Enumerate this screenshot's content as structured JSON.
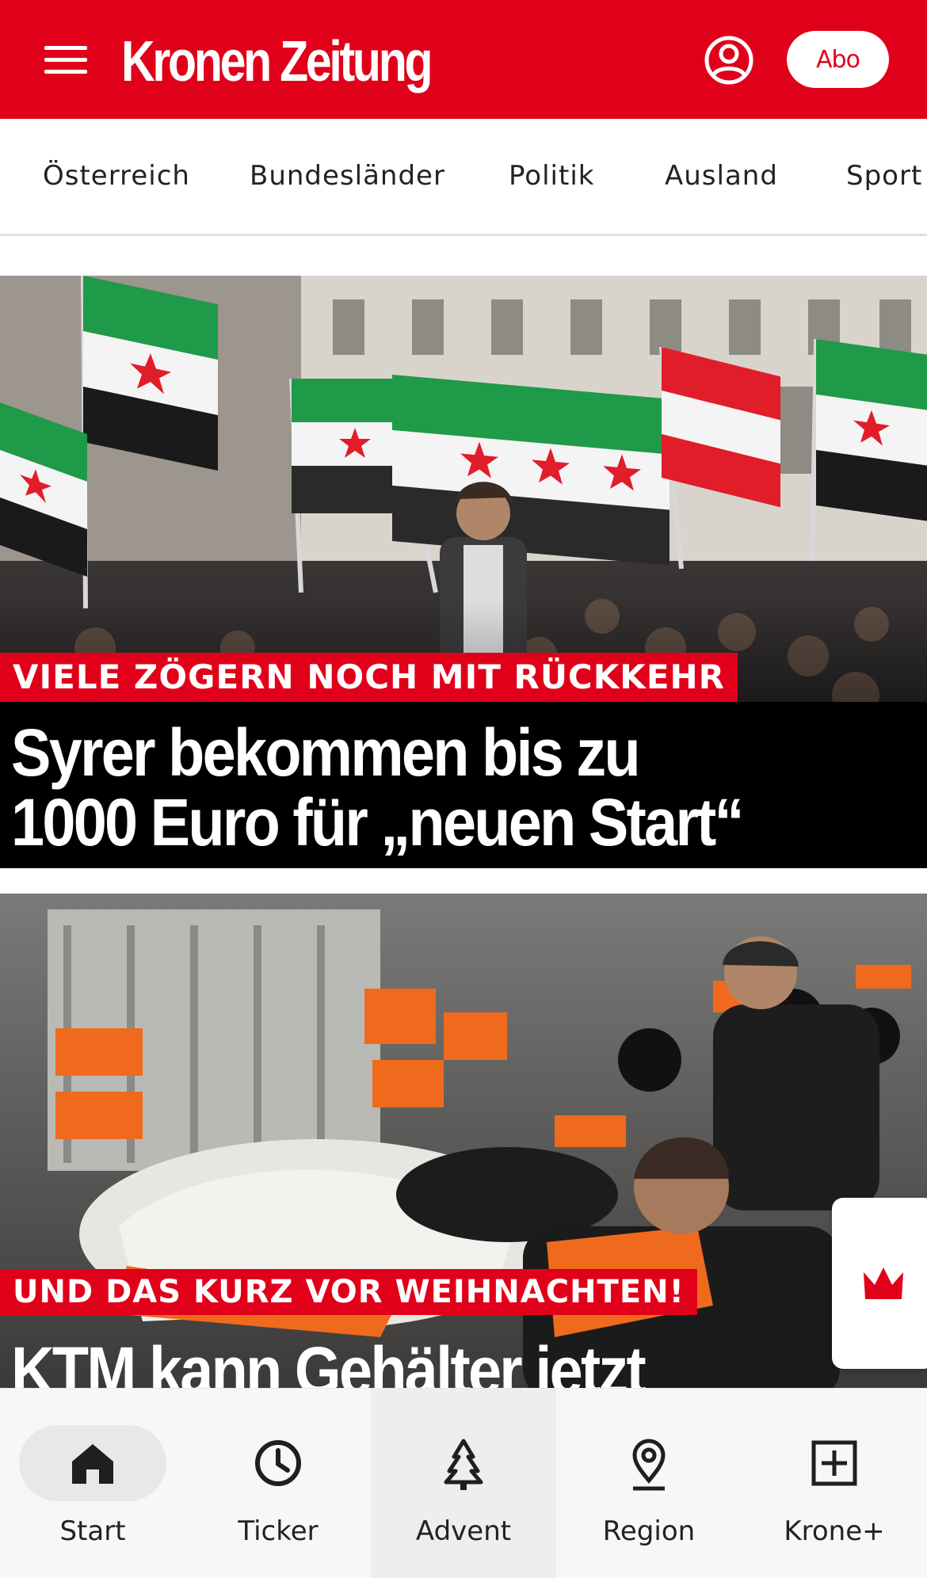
{
  "header": {
    "logo_text": "Kronen Zeitung",
    "subscribe_label": "Abo",
    "brand_color": "#e1001a",
    "menu_icon": "hamburger-menu-icon",
    "account_icon": "user-account-icon"
  },
  "nav": {
    "items": [
      {
        "label": "Österreich"
      },
      {
        "label": "Bundesländer"
      },
      {
        "label": "Politik"
      },
      {
        "label": "Ausland"
      },
      {
        "label": "Sport"
      }
    ]
  },
  "articles": [
    {
      "kicker": "VIELE ZÖGERN NOCH MIT RÜCKKEHR",
      "headline_line1": "Syrer bekommen bis zu",
      "headline_line2": "1000 Euro für „neuen Start“",
      "image_alt": "Crowd waving Syrian opposition flags and an Austrian flag"
    },
    {
      "kicker": "UND DAS KURZ VOR WEIHNACHTEN!",
      "headline_line1": "KTM kann Gehälter jetzt",
      "image_alt": "Workers assembling orange motorcycles in a factory"
    }
  ],
  "floating_button": {
    "icon": "krone-crown-icon"
  },
  "bottom_nav": {
    "items": [
      {
        "label": "Start",
        "icon": "home-icon",
        "active": true
      },
      {
        "label": "Ticker",
        "icon": "clock-icon"
      },
      {
        "label": "Advent",
        "icon": "tree-icon"
      },
      {
        "label": "Region",
        "icon": "location-pin-icon"
      },
      {
        "label": "Krone+",
        "icon": "plus-box-icon"
      }
    ]
  }
}
